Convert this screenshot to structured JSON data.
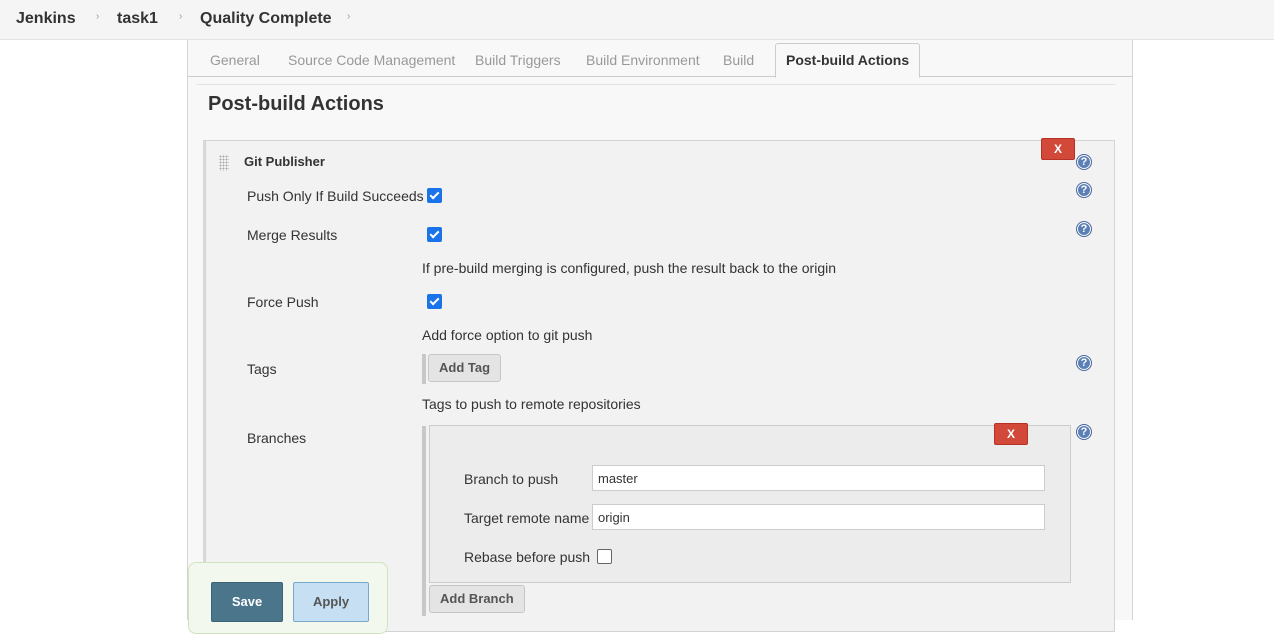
{
  "breadcrumb": {
    "items": [
      "Jenkins",
      "task1",
      "Quality Complete"
    ],
    "separator": "›"
  },
  "tabs": [
    {
      "label": "General"
    },
    {
      "label": "Source Code Management"
    },
    {
      "label": "Build Triggers"
    },
    {
      "label": "Build Environment"
    },
    {
      "label": "Build"
    },
    {
      "label": "Post-build Actions",
      "active": true
    }
  ],
  "section": {
    "title": "Post-build Actions"
  },
  "publisher": {
    "title": "Git Publisher",
    "remove_label": "X",
    "help_label": "?",
    "push_only_label": "Push Only If Build Succeeds",
    "push_only_checked": true,
    "merge_results_label": "Merge Results",
    "merge_results_checked": true,
    "merge_results_desc": "If pre-build merging is configured, push the result back to the origin",
    "force_push_label": "Force Push",
    "force_push_checked": true,
    "force_push_desc": "Add force option to git push",
    "tags_label": "Tags",
    "add_tag_label": "Add Tag",
    "tags_desc": "Tags to push to remote repositories",
    "branches_label": "Branches",
    "branch": {
      "remove_label": "X",
      "branch_to_push_label": "Branch to push",
      "branch_to_push_value": "master",
      "target_remote_label": "Target remote name",
      "target_remote_value": "origin",
      "rebase_label": "Rebase before push",
      "rebase_checked": false
    },
    "add_branch_label": "Add Branch"
  },
  "actions": {
    "save_label": "Save",
    "apply_label": "Apply"
  },
  "colors": {
    "accent": "#4b758b",
    "danger": "#d24939",
    "checkbox": "#1a73e8"
  }
}
